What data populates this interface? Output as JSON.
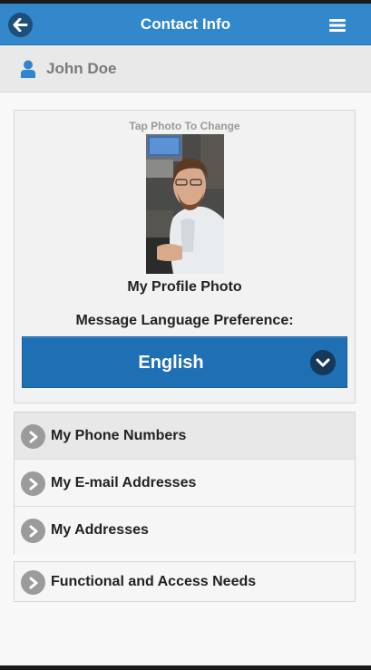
{
  "header": {
    "title": "Contact Info",
    "back_icon": "arrow-left-icon",
    "menu_icon": "hamburger-menu-icon"
  },
  "user": {
    "name": "John Doe",
    "icon": "person-icon"
  },
  "profile": {
    "tap_hint": "Tap Photo To Change",
    "photo_label": "My Profile Photo"
  },
  "language": {
    "label": "Message Language Preference:",
    "selected": "English"
  },
  "sections": [
    {
      "label": "My Phone Numbers"
    },
    {
      "label": "My E-mail Addresses"
    },
    {
      "label": "My Addresses"
    }
  ],
  "access": {
    "label": "Functional and Access Needs"
  },
  "colors": {
    "header_bg": "#3388cc",
    "select_bg": "#1f6fb5",
    "accent_dark": "#16395a"
  }
}
